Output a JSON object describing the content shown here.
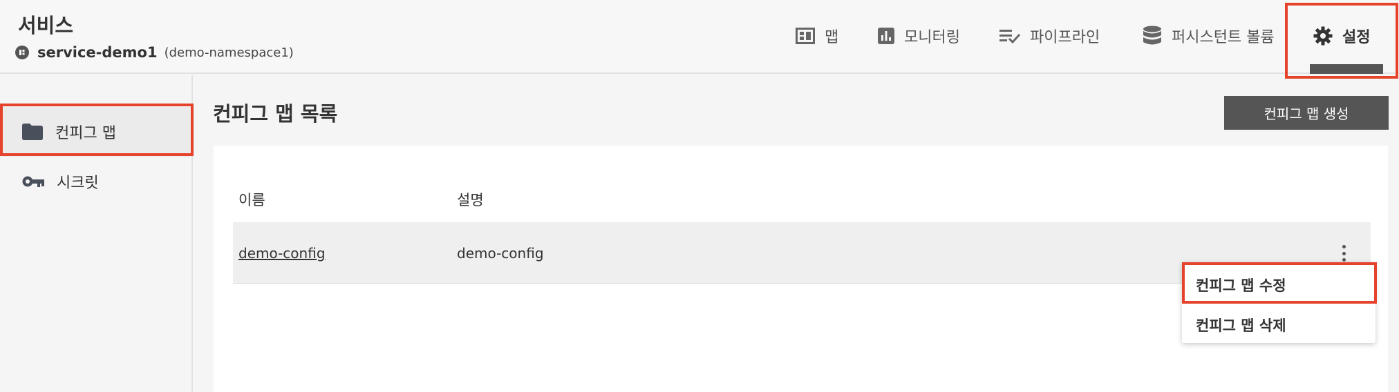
{
  "header": {
    "section_label": "서비스",
    "service_name": "service-demo1",
    "namespace": "(demo-namespace1)",
    "tabs": [
      {
        "label": "맵",
        "icon": "map-icon"
      },
      {
        "label": "모니터링",
        "icon": "monitoring-icon"
      },
      {
        "label": "파이프라인",
        "icon": "pipeline-icon"
      },
      {
        "label": "퍼시스턴트 볼륨",
        "icon": "database-icon"
      },
      {
        "label": "설정",
        "icon": "gear-icon",
        "active": true
      }
    ]
  },
  "sidebar": {
    "items": [
      {
        "label": "컨피그 맵",
        "icon": "folder-icon",
        "active": true
      },
      {
        "label": "시크릿",
        "icon": "key-icon"
      }
    ]
  },
  "main": {
    "title": "컨피그 맵 목록",
    "create_button": "컨피그 맵 생성",
    "table": {
      "columns": [
        "이름",
        "설명"
      ],
      "rows": [
        {
          "name": "demo-config",
          "description": "demo-config"
        }
      ]
    },
    "row_menu": {
      "items": [
        "컨피그 맵 수정",
        "컨피그 맵 삭제"
      ]
    }
  },
  "colors": {
    "highlight": "#e5432c",
    "dark_button": "#555555",
    "row_background": "#efefef"
  }
}
